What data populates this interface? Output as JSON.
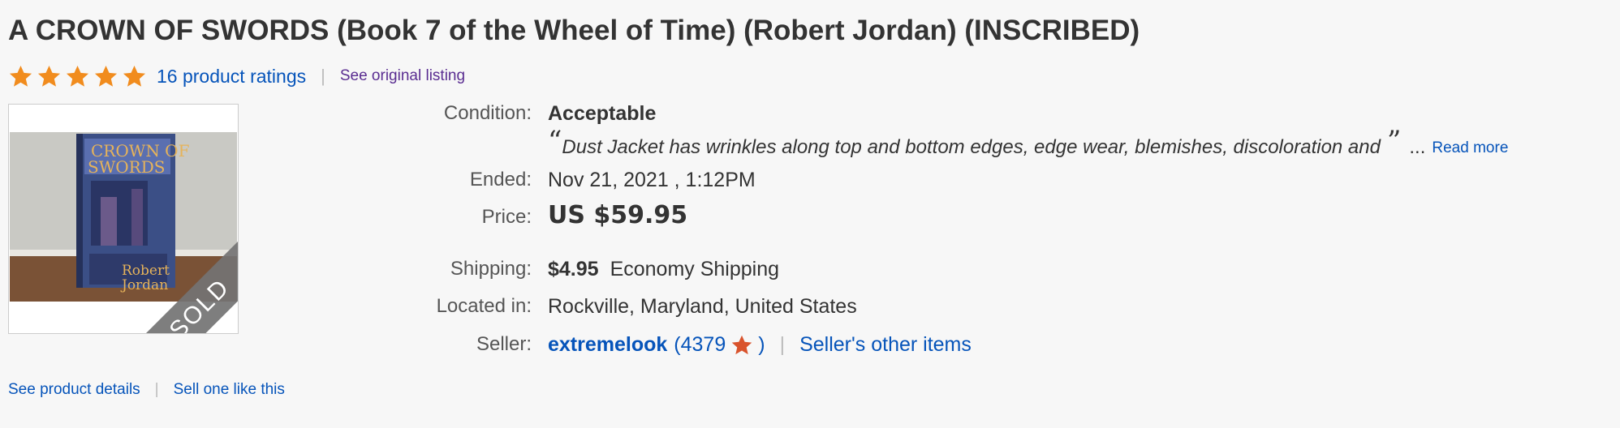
{
  "listing": {
    "title": "A CROWN OF SWORDS (Book 7 of the Wheel of Time) (Robert Jordan) (INSCRIBED)",
    "rating": {
      "stars": 5,
      "max": 5,
      "ratings_link": "16 product ratings"
    },
    "see_original": "See original listing",
    "image": {
      "sold_badge": "SOLD"
    },
    "details": {
      "condition_label": "Condition:",
      "condition_value": "Acceptable",
      "condition_open_quote": "“",
      "condition_description": "Dust Jacket has wrinkles along top and bottom edges, edge wear, blemishes, discoloration and",
      "condition_close_quote": "”",
      "condition_ellipsis": "...",
      "read_more": "Read more",
      "ended_label": "Ended:",
      "ended_value": "Nov 21, 2021 , 1:12PM",
      "price_label": "Price:",
      "price_value": "US $59.95",
      "shipping_label": "Shipping:",
      "shipping_cost": "$4.95",
      "shipping_method": "Economy Shipping",
      "location_label": "Located in:",
      "location_value": "Rockville, Maryland, United States",
      "seller_label": "Seller:",
      "seller_name": "extremelook",
      "seller_feedback_open": "(4379",
      "seller_feedback_close": ")",
      "seller_other_items": "Seller's other items"
    },
    "bottom_links": {
      "product_details": "See product details",
      "sell_one": "Sell one like this"
    },
    "separator": "|"
  },
  "colors": {
    "link_blue": "#0654ba",
    "visited_purple": "#5a2d91",
    "star_orange": "#f18c1e",
    "seller_star": "#d9532c",
    "text_dark": "#333333",
    "label_gray": "#555555"
  },
  "icons": {
    "rating_star": "star-icon",
    "seller_star": "seller-star-icon"
  }
}
